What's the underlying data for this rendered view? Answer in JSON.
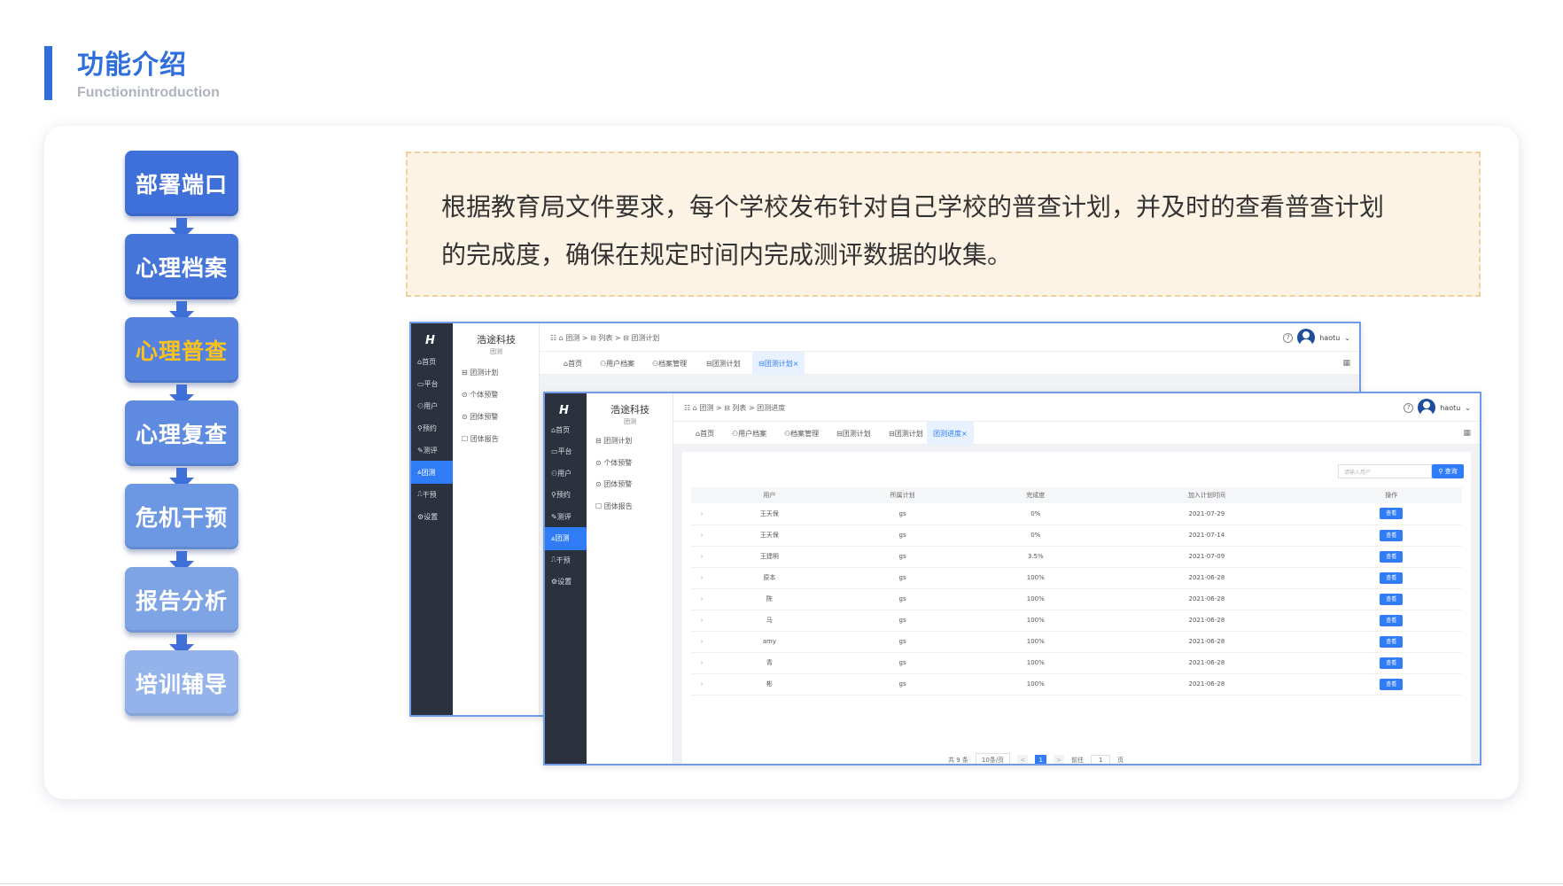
{
  "header": {
    "title": "功能介绍",
    "subtitle": "Functionintroduction"
  },
  "flow": {
    "steps": [
      {
        "label": "部署端口",
        "color": "#3f6fd8",
        "text_color": "#ffffff"
      },
      {
        "label": "心理档案",
        "color": "#4675da",
        "text_color": "#ffffff"
      },
      {
        "label": "心理普查",
        "color": "#5482de",
        "text_color": "#ffc21a"
      },
      {
        "label": "心理复查",
        "color": "#5e8be0",
        "text_color": "#ffffff"
      },
      {
        "label": "危机干预",
        "color": "#6c97e2",
        "text_color": "#ffffff"
      },
      {
        "label": "报告分析",
        "color": "#7ea4e6",
        "text_color": "#ffffff"
      },
      {
        "label": "培训辅导",
        "color": "#93b3ea",
        "text_color": "#ffffff"
      }
    ]
  },
  "description": {
    "line1": "根据教育局文件要求，每个学校发布针对自己学校的普查计划，并及时的查看普查计划",
    "line2": "的完成度，确保在规定时间内完成测评数据的收集。"
  },
  "app": {
    "logo": "H",
    "brand": "浩途科技",
    "brand_sub": "团测",
    "rail": [
      "首页",
      "平台",
      "用户",
      "预约",
      "测评",
      "团测",
      "干预",
      "设置"
    ],
    "submenu": [
      "团测计划",
      "个体预警",
      "团体预警",
      "团体报告"
    ],
    "user": "haotu",
    "help": "?",
    "grid_icon": "▦",
    "back": {
      "breadcrumb": "☷   ⌂ 团测  >  ⊟ 列表  >  ⊟ 团测计划",
      "tabs": [
        "首页",
        "用户档案",
        "档案管理",
        "团测计划",
        "团测计划"
      ]
    },
    "front": {
      "breadcrumb": "☷   ⌂ 团测  >  ⊟ 列表  >  团测进度",
      "tabs": [
        "首页",
        "用户档案",
        "档案管理",
        "团测计划",
        "团测计划",
        "团测进度"
      ],
      "search_placeholder": "请输入用户",
      "search_label": "查询",
      "columns": [
        "",
        "用户",
        "所属计划",
        "完成度",
        "加入计划时间",
        "操作"
      ],
      "rows": [
        [
          "王天保",
          "gs",
          "0%",
          "2021-07-29"
        ],
        [
          "王天保",
          "gs",
          "0%",
          "2021-07-14"
        ],
        [
          "王建明",
          "gs",
          "3.5%",
          "2021-07-09"
        ],
        [
          "原本",
          "gs",
          "100%",
          "2021-06-28"
        ],
        [
          "陈",
          "gs",
          "100%",
          "2021-06-28"
        ],
        [
          "马",
          "gs",
          "100%",
          "2021-06-28"
        ],
        [
          "amy",
          "gs",
          "100%",
          "2021-06-28"
        ],
        [
          "青",
          "gs",
          "100%",
          "2021-06-28"
        ],
        [
          "彬",
          "gs",
          "100%",
          "2021-06-28"
        ]
      ],
      "view_label": "查看",
      "pager": {
        "total": "共 9 条",
        "size": "10条/页",
        "prev": "<",
        "current": "1",
        "next": ">",
        "goto": "前往",
        "goto_value": "1",
        "page_unit": "页"
      }
    }
  }
}
